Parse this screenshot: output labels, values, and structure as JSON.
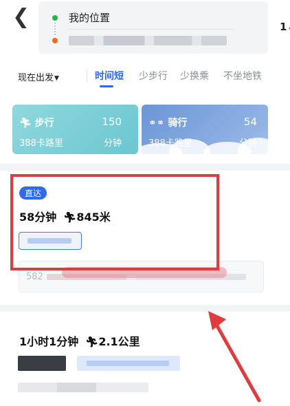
{
  "header": {
    "from": "我的位置",
    "swap_icon": "swap-vertical-icon"
  },
  "tabs": {
    "depart": "现在出发",
    "items": [
      "时间短",
      "少步行",
      "少换乘",
      "不坐地铁"
    ]
  },
  "cards": {
    "walk": {
      "title": "步行",
      "value": "150",
      "calories": "388卡路里",
      "unit": "分钟"
    },
    "bike": {
      "title": "骑行",
      "value": "54",
      "calories": "388卡路里",
      "unit": "分钟"
    }
  },
  "result1": {
    "badge": "直达",
    "duration": "58分钟",
    "walk": "845米",
    "detail_prefix": "582"
  },
  "result2": {
    "duration": "1小时1分钟",
    "walk": "2.1公里"
  },
  "colors": {
    "accent": "#2b6bf3",
    "highlight": "#e23b3b"
  }
}
